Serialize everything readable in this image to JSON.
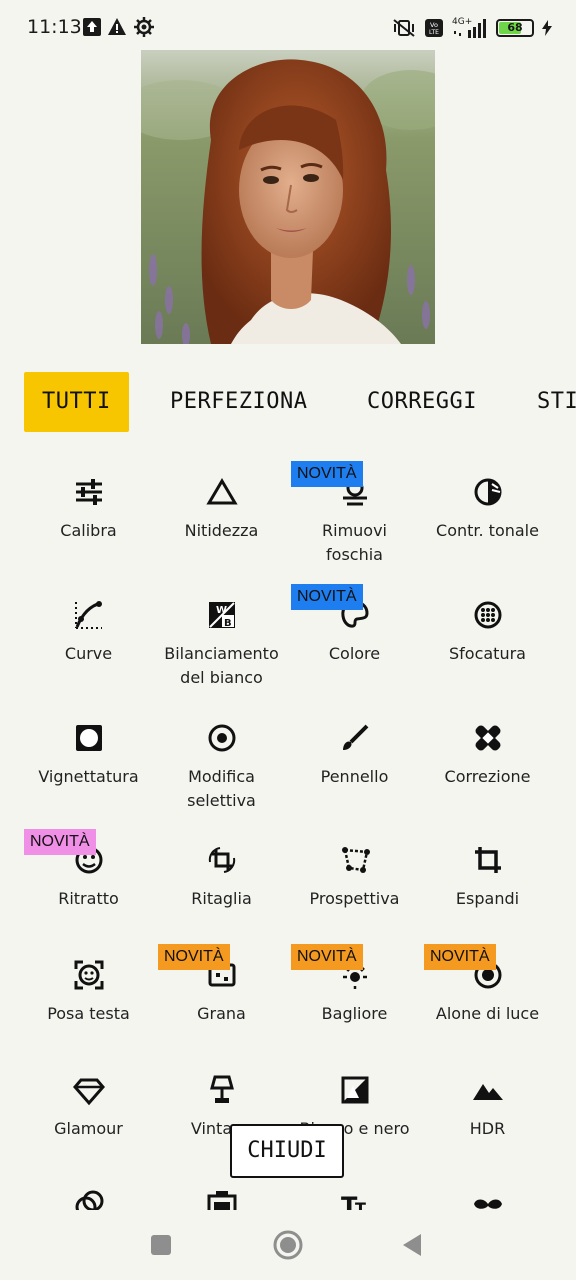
{
  "status_bar": {
    "time": "11:13",
    "network": "4G+",
    "volte": "Vo LTE",
    "battery_level": "68",
    "battery_fraction": 0.68
  },
  "tabs": [
    {
      "label": "TUTTI",
      "active": true
    },
    {
      "label": "PERFEZIONA",
      "active": false
    },
    {
      "label": "CORREGGI",
      "active": false
    },
    {
      "label": "STI",
      "active": false
    }
  ],
  "tools": [
    {
      "label": "Calibra",
      "icon": "sliders-icon"
    },
    {
      "label": "Nitidezza",
      "icon": "triangle-icon"
    },
    {
      "label": "Rimuovi\nfoschia",
      "icon": "haze-icon",
      "badge": "NOVITÀ"
    },
    {
      "label": "Contr. tonale",
      "icon": "half-circle-icon"
    },
    {
      "label": "Curve",
      "icon": "curve-icon"
    },
    {
      "label": "Bilanciamento\ndel bianco",
      "icon": "white-balance-icon"
    },
    {
      "label": "Colore",
      "icon": "palette-icon",
      "badge": "NOVITÀ"
    },
    {
      "label": "Sfocatura",
      "icon": "blur-icon"
    },
    {
      "label": "Vignettatura",
      "icon": "vignette-icon"
    },
    {
      "label": "Modifica\nselettiva",
      "icon": "target-icon"
    },
    {
      "label": "Pennello",
      "icon": "brush-icon"
    },
    {
      "label": "Correzione",
      "icon": "bandage-icon"
    },
    {
      "label": "Ritratto",
      "icon": "face-icon",
      "badge": "NOVITÀ"
    },
    {
      "label": "Ritaglia",
      "icon": "rotate-crop-icon"
    },
    {
      "label": "Prospettiva",
      "icon": "perspective-icon"
    },
    {
      "label": "Espandi",
      "icon": "crop-icon"
    },
    {
      "label": "Posa testa",
      "icon": "face-frame-icon"
    },
    {
      "label": "Grana",
      "icon": "grain-icon",
      "badge": "NOVITÀ"
    },
    {
      "label": "Bagliore",
      "icon": "glow-icon",
      "badge": "NOVITÀ"
    },
    {
      "label": "Alone di luce",
      "icon": "halo-icon",
      "badge": "NOVITÀ"
    },
    {
      "label": "Glamour",
      "icon": "diamond-icon"
    },
    {
      "label": "Vintage",
      "icon": "lamp-icon"
    },
    {
      "label": "Bianco e nero",
      "icon": "black-white-icon"
    },
    {
      "label": "HDR",
      "icon": "mountains-icon"
    },
    {
      "label": "",
      "icon": "rings-icon"
    },
    {
      "label": "",
      "icon": "frame-icon"
    },
    {
      "label": "",
      "icon": "text-icon"
    },
    {
      "label": "",
      "icon": "mustache-icon"
    }
  ],
  "close_button": "CHIUDI",
  "colors": {
    "background": "#f5f5f0",
    "active_tab": "#f7c600",
    "badge_blue": "#1e7ef0",
    "badge_pink": "#f08fe6",
    "badge_orange": "#f59a21"
  }
}
